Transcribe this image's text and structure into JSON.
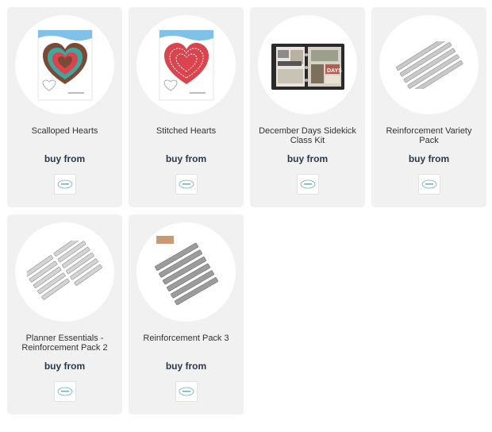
{
  "products": [
    {
      "title": "Scalloped Hearts",
      "cta": "buy from",
      "image": "scalloped-hearts-package",
      "retailer_logo": "retailer-logo-icon"
    },
    {
      "title": "Stitched Hearts",
      "cta": "buy from",
      "image": "stitched-hearts-package",
      "retailer_logo": "retailer-logo-icon"
    },
    {
      "title": "December Days Sidekick Class Kit",
      "cta": "buy from",
      "image": "sidekick-class-kit-photo",
      "retailer_logo": "retailer-logo-icon"
    },
    {
      "title": "Reinforcement Variety Pack",
      "cta": "buy from",
      "image": "reinforcement-strips-dies",
      "retailer_logo": "retailer-logo-icon"
    },
    {
      "title": "Planner Essentials - Reinforcement Pack 2",
      "cta": "buy from",
      "image": "planner-reinforcement-dies",
      "retailer_logo": "retailer-logo-icon"
    },
    {
      "title": "Reinforcement Pack 3",
      "cta": "buy from",
      "image": "reinforcement-pack-3-dies",
      "retailer_logo": "retailer-logo-icon"
    }
  ],
  "colors": {
    "card_bg": "#f1f1f1",
    "cta_text": "#2b3a4a",
    "title_text": "#333333",
    "package_header": "#7fc1e8",
    "heart_brown": "#7a4a34",
    "heart_teal": "#3fa7a0",
    "heart_red": "#d9444f"
  }
}
